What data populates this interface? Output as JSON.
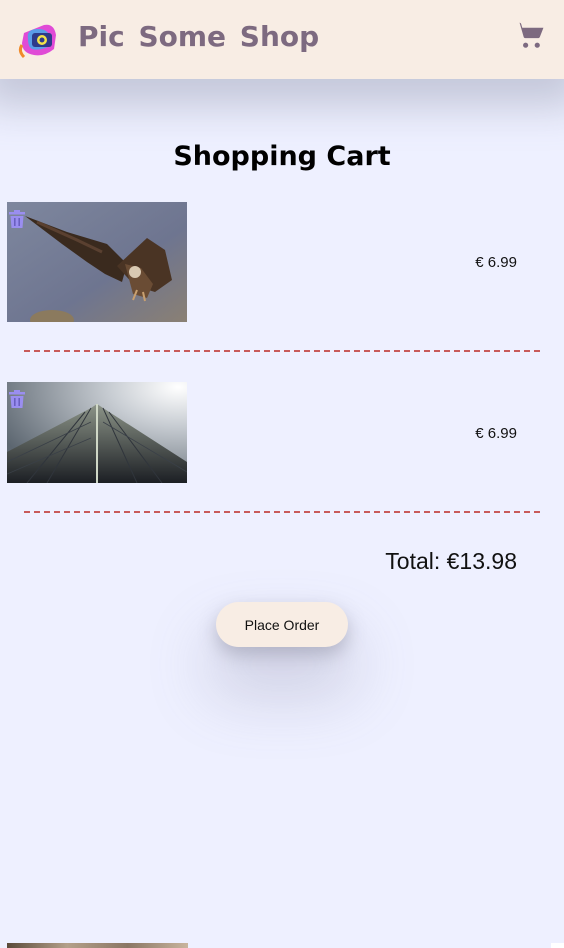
{
  "header": {
    "brand": "Pic Some Shop",
    "logo_icon": "camera-logo-icon",
    "cart_icon": "shopping-cart-icon"
  },
  "page": {
    "title": "Shopping Cart"
  },
  "cart": {
    "items": [
      {
        "image": "vulture-in-flight-photo",
        "price": "€ 6.99",
        "remove_icon": "trash-icon"
      },
      {
        "image": "skyscraper-photo",
        "price": "€ 6.99",
        "remove_icon": "trash-icon"
      }
    ],
    "total": "Total: €13.98",
    "order_button": "Place Order"
  },
  "colors": {
    "header_bg": "#f8ede4",
    "page_bg": "#eef0ff",
    "brand_text": "#7d6a80",
    "trash_icon": "#9a8ef0",
    "divider": "#c85a5a"
  }
}
